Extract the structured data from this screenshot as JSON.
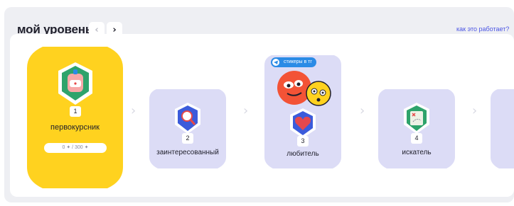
{
  "header": {
    "title": "мой уровень",
    "prev_label": "‹",
    "next_label": "›",
    "how_link": "как это работает?"
  },
  "levels": [
    {
      "number": "1",
      "name": "первокурсник",
      "progress": "0 ✦ / 300 ✦",
      "active": true,
      "badge_icon": "backpack-icon"
    },
    {
      "number": "2",
      "name": "заинтересованный",
      "active": false,
      "badge_icon": "magnifier-icon"
    },
    {
      "number": "3",
      "name": "любитель",
      "active": false,
      "badge_icon": "heart-icon",
      "tag": "стикеры в тг"
    },
    {
      "number": "4",
      "name": "искатель",
      "active": false,
      "badge_icon": "map-icon"
    }
  ],
  "colors": {
    "active_card": "#ffd21f",
    "inactive_card": "#dcdcf6",
    "accent": "#4b55e4",
    "telegram": "#2b8be6"
  }
}
